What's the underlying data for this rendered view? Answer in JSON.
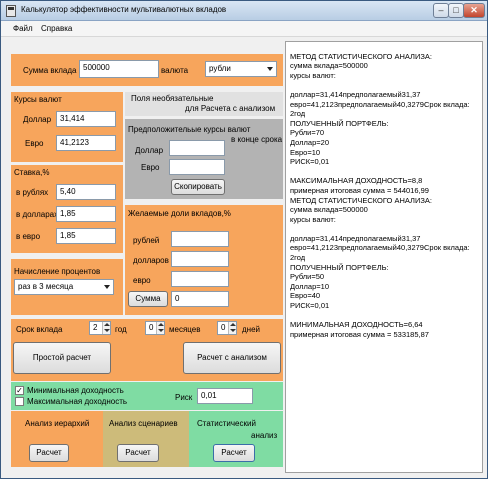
{
  "window": {
    "title": "Калькулятор эффективности мультивалютных вкладов",
    "min": "–",
    "max": "□",
    "close": "✕"
  },
  "menu": {
    "file": "Файл",
    "help": "Справка"
  },
  "deposit": {
    "label": "Сумма вклада",
    "value": "500000",
    "currency_label": "валюта",
    "currency_value": "рубли"
  },
  "rates": {
    "title": "Курсы валют",
    "dollar_label": "Доллар",
    "dollar_value": "31,414",
    "euro_label": "Евро",
    "euro_value": "41,2123"
  },
  "optional": {
    "title1": "Поля необязательные",
    "title2": "для Расчета с анализом"
  },
  "expected": {
    "title1": "Предположительые курсы валют",
    "title2": "в конце срока",
    "dollar_label": "Доллар",
    "euro_label": "Евро",
    "copy_button": "Скопировать"
  },
  "stake": {
    "title": "Ставка,%",
    "rub_label": "в рублях",
    "rub_value": "5,40",
    "usd_label": "в долларах",
    "usd_value": "1,85",
    "eur_label": "в евро",
    "eur_value": "1,85"
  },
  "shares": {
    "title": "Желаемые доли вкладов,%",
    "rub_label": "рублей",
    "usd_label": "долларов",
    "eur_label": "евро",
    "sum_button": "Сумма",
    "sum_value": "0"
  },
  "interest": {
    "title": "Начисление процентов",
    "value": "раз в 3 месяца"
  },
  "term": {
    "label": "Срок вклада",
    "years_value": "2",
    "years_label": "год",
    "months_value": "0",
    "months_label": "месяцев",
    "days_value": "0",
    "days_label": "дней"
  },
  "actions": {
    "simple": "Простой расчет",
    "analysis": "Расчет с анализом"
  },
  "options": {
    "min_label": "Минимальная доходность",
    "min_checked": "✓",
    "max_label": "Максимальная доходность",
    "risk_label": "Риск",
    "risk_value": "0,01"
  },
  "analysis": {
    "hier_title": "Анализ иерархий",
    "hier_button": "Расчет",
    "scen_title": "Анализ сценариев",
    "scen_button": "Расчет",
    "stat_title1": "Статистический",
    "stat_title2": "анализ",
    "stat_button": "Расчет"
  },
  "output_lines": [
    "",
    "МЕТОД СТАТИСТИЧЕСКОГО АНАЛИЗА:",
    "сумма вклада=500000",
    "курсы валют:",
    "",
    "доллар=31,414предполагаемый31,37",
    "евро=41,2123предполагаемый40,3279Срок вклада:",
    "2год",
    "ПОЛУЧЕННЫЙ ПОРТФЕЛЬ:",
    "Рубли=70",
    "Доллар=20",
    "Евро=10",
    "РИСК=0,01",
    "",
    "МАКСИМАЛЬНАЯ ДОХОДНОСТЬ=8,8",
    "примерная итоговая сумма = 544016,99",
    "МЕТОД СТАТИСТИЧЕСКОГО АНАЛИЗА:",
    "сумма вклада=500000",
    "курсы валют:",
    "",
    "доллар=31,414предполагаемый31,37",
    "евро=41,2123предполагаемый40,3279Срок вклада:",
    "2год",
    "ПОЛУЧЕННЫЙ ПОРТФЕЛЬ:",
    "Рубли=50",
    "Доллар=10",
    "Евро=40",
    "РИСК=0,01",
    "",
    "МИНИМАЛЬНАЯ ДОХОДНОСТЬ=6,64",
    "примерная итоговая сумма = 533185,87"
  ]
}
